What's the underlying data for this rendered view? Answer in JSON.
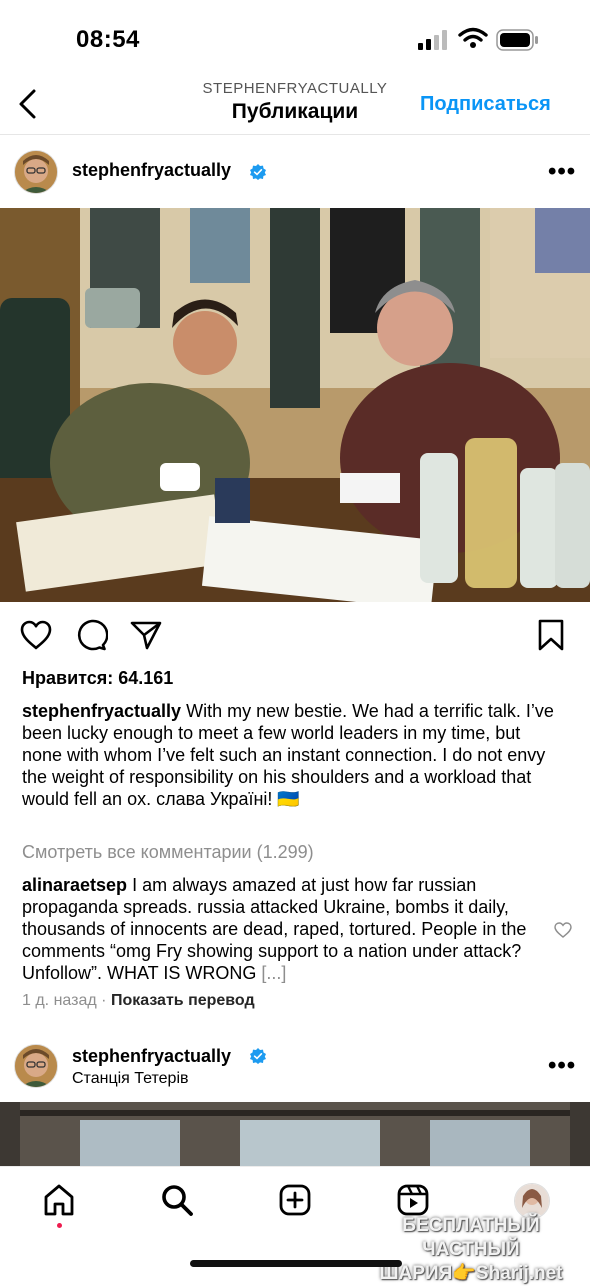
{
  "status_bar": {
    "time": "08:54"
  },
  "header": {
    "username": "STEPHENFRYACTUALLY",
    "title": "Публикации",
    "follow_label": "Подписаться"
  },
  "post1": {
    "username": "stephenfryactually",
    "likes": "Нравится: 64.161",
    "caption_user": "stephenfryactually",
    "caption_text": "With my new bestie. We had a terrific talk. I’ve been lucky enough to meet a few world leaders in my time, but none with whom I’ve felt such an instant connection. I do not envy the weight of responsibility on his shoulders and a workload that would fell an ox. слава Україні! 🇺🇦",
    "view_comments": "Смотреть все комментарии (1.299)",
    "comment_user": "alinaraetsep",
    "comment_text": "I am always amazed at just how far russian propaganda spreads. russia attacked Ukraine, bombs it daily, thousands of innocents are dead, raped, tortured. People in the comments “omg Fry showing support to a nation under attack? Unfollow”. WHAT IS WRONG",
    "comment_more": "[...]",
    "time_ago": "1 д. назад",
    "separator": "·",
    "translate": "Показать перевод"
  },
  "post2": {
    "username": "stephenfryactually",
    "location": "Станція Тетерів"
  },
  "watermark": {
    "line1": "БЕСПЛАТНЫЙ ЧАСТНЫЙ",
    "line2": "ШАРИЯ👉Sharij.net"
  },
  "colors": {
    "accent": "#0a95f6",
    "verified": "#1d9bf0",
    "muted": "#8e8e8e",
    "notify_dot": "#ed1c4f"
  }
}
